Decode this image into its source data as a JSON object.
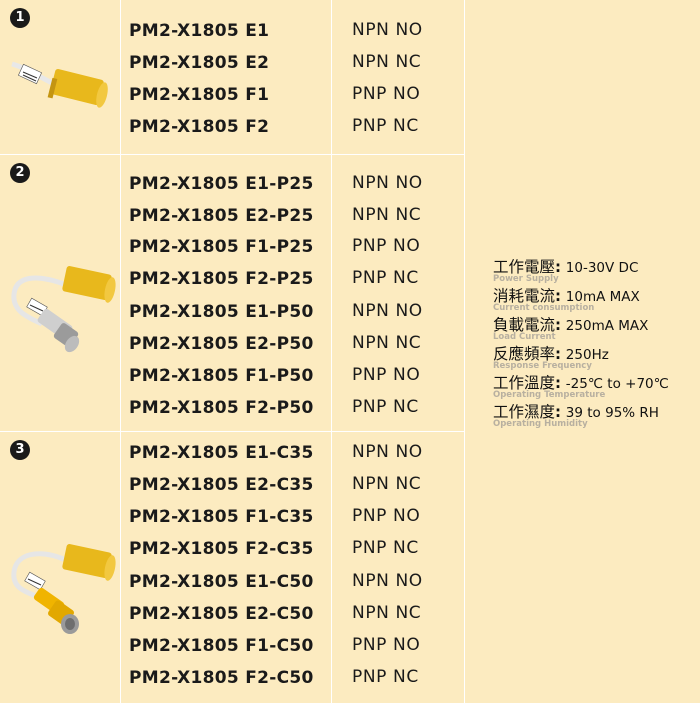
{
  "groups": [
    {
      "number": "1",
      "image": "sensor-short-cable",
      "models": [
        "PM2-X1805 E1",
        "PM2-X1805 E2",
        "PM2-X1805 F1",
        "PM2-X1805 F2"
      ],
      "types": [
        "NPN NO",
        "NPN NC",
        "PNP NO",
        "PNP NC"
      ]
    },
    {
      "number": "2",
      "image": "sensor-with-p-connector",
      "models": [
        "PM2-X1805 E1-P25",
        "PM2-X1805 E2-P25",
        "PM2-X1805 F1-P25",
        "PM2-X1805 F2-P25",
        "PM2-X1805 E1-P50",
        "PM2-X1805 E2-P50",
        "PM2-X1805 F1-P50",
        "PM2-X1805 F2-P50"
      ],
      "types": [
        "NPN NO",
        "NPN NC",
        "PNP NO",
        "PNP NC",
        "NPN NO",
        "NPN NC",
        "PNP NO",
        "PNP NC"
      ]
    },
    {
      "number": "3",
      "image": "sensor-with-c-connector",
      "models": [
        "PM2-X1805 E1-C35",
        "PM2-X1805 E2-C35",
        "PM2-X1805 F1-C35",
        "PM2-X1805 F2-C35",
        "PM2-X1805 E1-C50",
        "PM2-X1805 E2-C50",
        "PM2-X1805 F1-C50",
        "PM2-X1805 F2-C50"
      ],
      "types": [
        "NPN NO",
        "NPN NC",
        "PNP NO",
        "PNP NC",
        "NPN NO",
        "NPN NC",
        "PNP NO",
        "PNP NC"
      ]
    }
  ],
  "specs": [
    {
      "label": "工作電壓",
      "colon": ":",
      "value": "10-30V DC",
      "sub": "Power Supply"
    },
    {
      "label": "消耗電流",
      "colon": ":",
      "value": "10mA MAX",
      "sub": "Current consumption"
    },
    {
      "label": "負載電流",
      "colon": ":",
      "value": "250mA MAX",
      "sub": "Load Current"
    },
    {
      "label": "反應頻率",
      "colon": ":",
      "value": "250Hz",
      "sub": "Response Frequency"
    },
    {
      "label": "工作溫度",
      "colon": ":",
      "value": "-25℃ to +70℃",
      "sub": "Operating Temperature"
    },
    {
      "label": "工作濕度",
      "colon": ":",
      "value": "39 to 95% RH",
      "sub": "Operating Humidity"
    }
  ],
  "colors": {
    "cell_bg": "#fcebc0",
    "sensor_yellow": "#e8b81c",
    "border": "#ffffff"
  }
}
